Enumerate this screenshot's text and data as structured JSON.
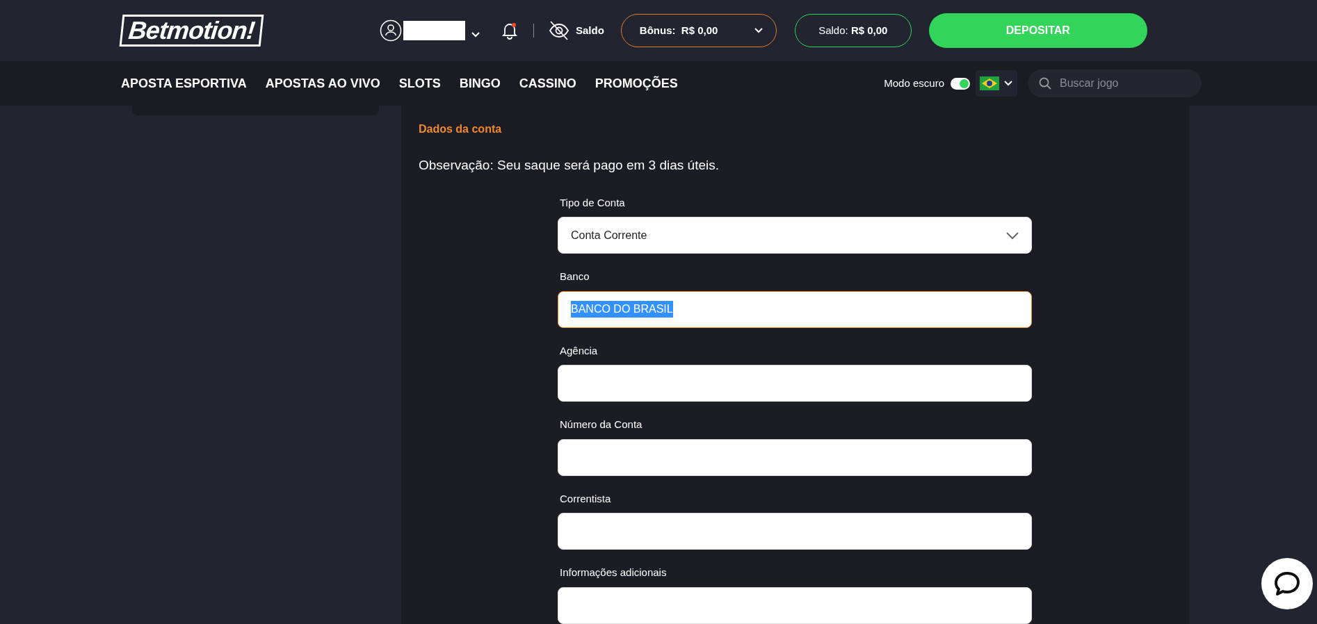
{
  "header": {
    "logo": "Betmotion!",
    "balance_toggle_label": "Saldo",
    "bonus": {
      "label": "Bônus:",
      "value": "R$ 0,00"
    },
    "balance": {
      "label": "Saldo:",
      "value": "R$ 0,00"
    },
    "deposit_button": "DEPOSITAR",
    "notification_unread": true
  },
  "nav": {
    "items": [
      "APOSTA ESPORTIVA",
      "APOSTAS AO VIVO",
      "SLOTS",
      "BINGO",
      "CASSINO",
      "PROMOÇÕES"
    ],
    "dark_mode": {
      "label": "Modo escuro",
      "on": true
    },
    "search": {
      "placeholder": "Buscar jogo"
    }
  },
  "account": {
    "heading": "Dados da conta",
    "note": "Observação: Seu saque será pago em 3 dias úteis.",
    "fields": [
      {
        "kind": "select",
        "label": "Tipo de Conta",
        "value": "Conta Corrente",
        "focused": false
      },
      {
        "kind": "text",
        "label": "Banco",
        "value": "BANCO DO BRASIL",
        "focused": true,
        "text_selected": true
      },
      {
        "kind": "text",
        "label": "Agência",
        "focused": false
      },
      {
        "kind": "text",
        "label": "Número da Conta",
        "focused": false
      },
      {
        "kind": "text",
        "label": "Correntista",
        "focused": false
      },
      {
        "kind": "text",
        "label": "Informações adicionais",
        "focused": false
      }
    ]
  }
}
